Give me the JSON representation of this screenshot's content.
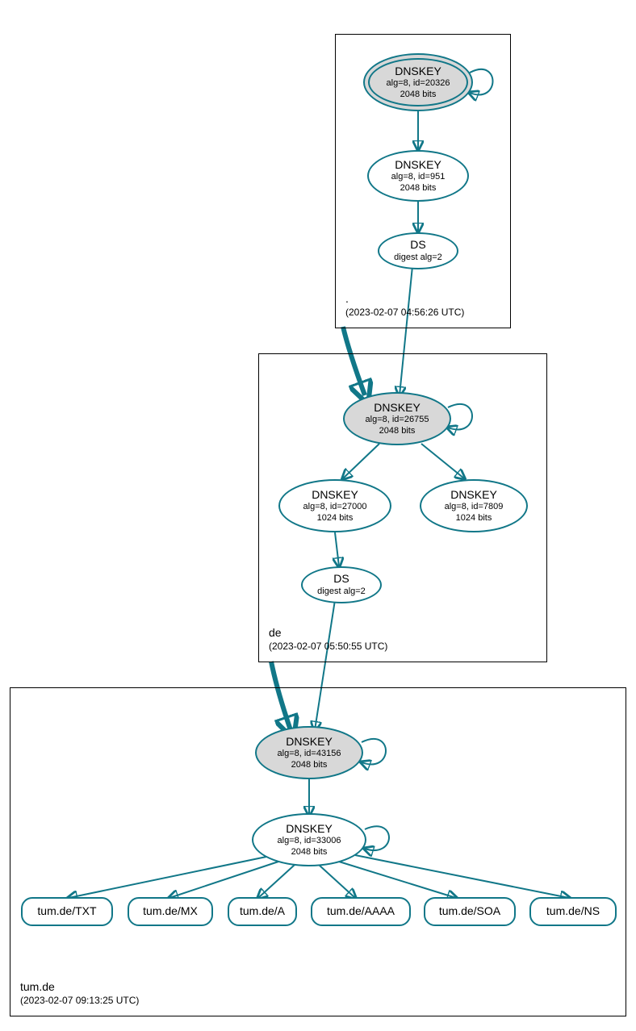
{
  "colors": {
    "stroke": "#117788",
    "fill_grey": "#d8d8d8"
  },
  "zones": {
    "root": {
      "name": ".",
      "timestamp": "(2023-02-07 04:56:26 UTC)"
    },
    "de": {
      "name": "de",
      "timestamp": "(2023-02-07 05:50:55 UTC)"
    },
    "tum": {
      "name": "tum.de",
      "timestamp": "(2023-02-07 09:13:25 UTC)"
    }
  },
  "nodes": {
    "root_ksk": {
      "title": "DNSKEY",
      "line1": "alg=8, id=20326",
      "line2": "2048 bits"
    },
    "root_zsk": {
      "title": "DNSKEY",
      "line1": "alg=8, id=951",
      "line2": "2048 bits"
    },
    "root_ds": {
      "title": "DS",
      "line1": "digest alg=2"
    },
    "de_ksk": {
      "title": "DNSKEY",
      "line1": "alg=8, id=26755",
      "line2": "2048 bits"
    },
    "de_zsk1": {
      "title": "DNSKEY",
      "line1": "alg=8, id=27000",
      "line2": "1024 bits"
    },
    "de_zsk2": {
      "title": "DNSKEY",
      "line1": "alg=8, id=7809",
      "line2": "1024 bits"
    },
    "de_ds": {
      "title": "DS",
      "line1": "digest alg=2"
    },
    "tum_ksk": {
      "title": "DNSKEY",
      "line1": "alg=8, id=43156",
      "line2": "2048 bits"
    },
    "tum_zsk": {
      "title": "DNSKEY",
      "line1": "alg=8, id=33006",
      "line2": "2048 bits"
    },
    "rr_txt": {
      "label": "tum.de/TXT"
    },
    "rr_mx": {
      "label": "tum.de/MX"
    },
    "rr_a": {
      "label": "tum.de/A"
    },
    "rr_aaaa": {
      "label": "tum.de/AAAA"
    },
    "rr_soa": {
      "label": "tum.de/SOA"
    },
    "rr_ns": {
      "label": "tum.de/NS"
    }
  }
}
